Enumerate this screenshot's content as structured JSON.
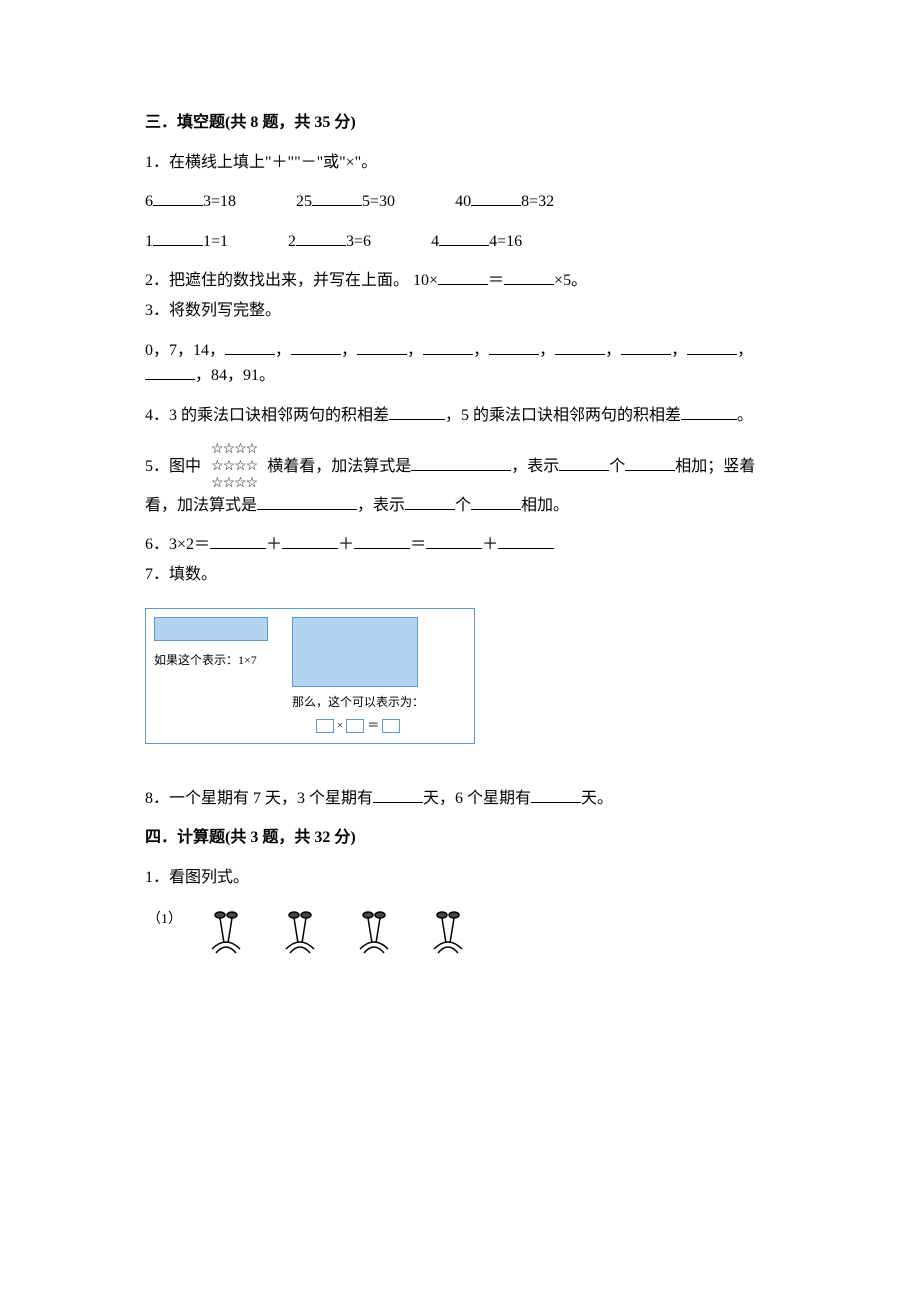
{
  "section3": {
    "header": "三．填空题(共 8 题，共 35 分)",
    "q1": {
      "text": "1．在横线上填上\"＋\"\"－\"或\"×\"。",
      "row1": {
        "a": "6",
        "aR": "3=18",
        "b": "25",
        "bR": "5=30",
        "c": "40",
        "cR": "8=32"
      },
      "row2": {
        "a": "1",
        "aR": "1=1",
        "b": "2",
        "bR": "3=6",
        "c": "4",
        "cR": "4=16"
      }
    },
    "q2": {
      "pre": "2．把遮住的数找出来，并写在上面。 10×",
      "mid": "＝",
      "post": "×5。"
    },
    "q3": {
      "title": "3．将数列写完整。",
      "prefix": "0，7，14，",
      "suffix": "，84，91。"
    },
    "q4": {
      "a": "4．3 的乘法口诀相邻两句的积相差",
      "b": "，5 的乘法口诀相邻两句的积相差",
      "c": "。"
    },
    "q5": {
      "stars": "☆☆☆☆",
      "a": "5．图中",
      "b": " 横着看，加法算式是",
      "c": "，表示",
      "d": "个",
      "e": "相加；竖着看，加法算式是",
      "f": "，表示",
      "g": "个",
      "h": "相加。"
    },
    "q6": {
      "a": "6．3×2＝",
      "p": "＋",
      "eq": "＝"
    },
    "q7": {
      "title": "7．填数。",
      "leftLabel": "如果这个表示：1×7",
      "rightLabel": "那么，这个可以表示为：",
      "times": "×",
      "eq": "＝"
    },
    "q8": {
      "a": "8．一个星期有 7 天，3 个星期有",
      "b": "天，6 个星期有",
      "c": "天。"
    }
  },
  "section4": {
    "header": "四．计算题(共 3 题，共 32 分)",
    "q1": {
      "title": "1．看图列式。",
      "idx": "（1）"
    }
  }
}
